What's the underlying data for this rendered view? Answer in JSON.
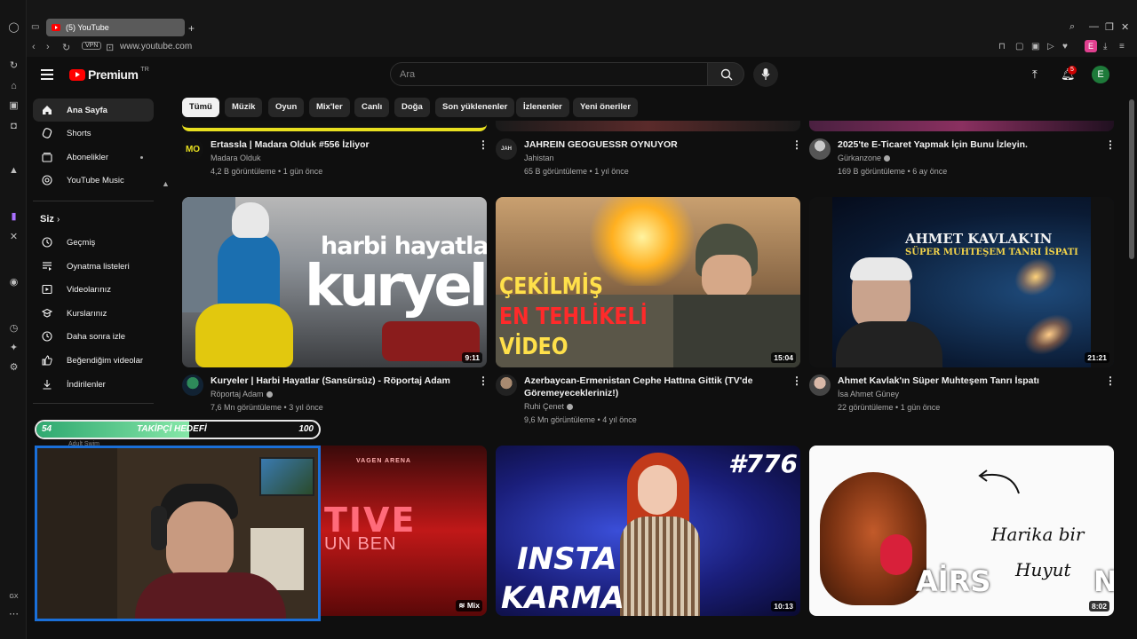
{
  "browser": {
    "tab_title": "(5) YouTube",
    "url": "www.youtube.com",
    "vpn_label": "VPN",
    "ext_avatar": "E",
    "bottom_label": "GX"
  },
  "header": {
    "logo_text": "Premium",
    "logo_country": "TR",
    "search_placeholder": "Ara",
    "notifications_count": "5",
    "avatar_letter": "E"
  },
  "sidebar": {
    "items": [
      {
        "label": "Ana Sayfa",
        "icon": "home-icon"
      },
      {
        "label": "Shorts",
        "icon": "shorts-icon"
      },
      {
        "label": "Abonelikler",
        "icon": "subscriptions-icon"
      },
      {
        "label": "YouTube Music",
        "icon": "music-icon"
      }
    ],
    "you_heading": "Siz",
    "you_items": [
      {
        "label": "Geçmiş",
        "icon": "history-icon"
      },
      {
        "label": "Oynatma listeleri",
        "icon": "playlists-icon"
      },
      {
        "label": "Videolarınız",
        "icon": "your-videos-icon"
      },
      {
        "label": "Kurslarınız",
        "icon": "courses-icon"
      },
      {
        "label": "Daha sonra izle",
        "icon": "watch-later-icon"
      },
      {
        "label": "Beğendiğim videolar",
        "icon": "liked-icon"
      },
      {
        "label": "İndirilenler",
        "icon": "downloads-icon"
      }
    ]
  },
  "chips": [
    "Tümü",
    "Müzik",
    "Oyun",
    "Mix'ler",
    "Canlı",
    "Doğa",
    "Son yüklenenler",
    "İzlenenler",
    "Yeni öneriler"
  ],
  "videos_row1": [
    {
      "title": "Ertassla | Madara Olduk #556 İzliyor",
      "channel": "Madara Olduk",
      "meta": "4,2 B görüntüleme • 1 gün önce",
      "avatar_text": "MO"
    },
    {
      "title": "JAHREIN GEOGUESSR OYNUYOR",
      "channel": "Jahistan",
      "meta": "65 B görüntüleme • 1 yıl önce",
      "avatar_text": "JAH"
    },
    {
      "title": "2025'te E-Ticaret Yapmak İçin Bunu İzleyin.",
      "channel": "Gürkanzone",
      "meta": "169 B görüntüleme • 6 ay önce",
      "avatar_text": ""
    }
  ],
  "videos_row2": [
    {
      "title": "Kuryeler | Harbi Hayatlar (Sansürsüz) - Röportaj Adam",
      "channel": "Röportaj Adam",
      "meta": "7,6 Mn görüntüleme • 3 yıl önce",
      "duration": "9:11",
      "thumb_line1": "harbi hayatlar",
      "thumb_line2": "kuryeler"
    },
    {
      "title": "Azerbaycan-Ermenistan Cephe Hattına Gittik (TV'de Göremeyecekleriniz!)",
      "channel": "Ruhi Çenet",
      "meta": "9,6 Mn görüntüleme • 4 yıl önce",
      "duration": "15:04",
      "thumb_line1": "ÇEKİLMİŞ",
      "thumb_line2": "EN TEHLİKELİ",
      "thumb_line3": "VİDEO"
    },
    {
      "title": "Ahmet Kavlak'ın Süper Muhteşem Tanrı İspatı",
      "channel": "İsa Ahmet Güney",
      "meta": "22 görüntüleme • 1 gün önce",
      "duration": "21:21",
      "thumb_line1": "AHMET KAVLAK'IN",
      "thumb_line2": "SÜPER MUHTEŞEM TANRI İSPATI"
    }
  ],
  "videos_row3": [
    {
      "duration": "Mix",
      "thumb_line1": "TIVE",
      "thumb_line2": "UN BEN",
      "thumb_small": "VAGEN ARENA"
    },
    {
      "duration": "10:13",
      "thumb_line1": "#776",
      "thumb_line2": "INSTA",
      "thumb_line3": "KARMA"
    },
    {
      "duration": "8:02",
      "thumb_line1": "Harika bir",
      "thumb_line2": "Huyut",
      "thumb_line3": "AİRS",
      "thumb_line4": "N"
    }
  ],
  "overlay": {
    "goal_current": "54",
    "goal_label": "TAKİPÇİ HEDEFİ",
    "goal_target": "100",
    "goal_fraction": 0.54,
    "behind_text": "Adult Swim"
  }
}
